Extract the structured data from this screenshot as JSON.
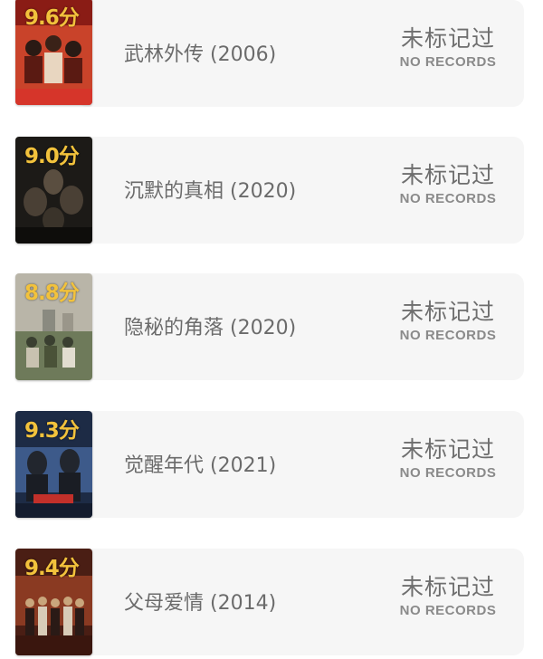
{
  "items": [
    {
      "score": "9.6分",
      "title": "武林外传 (2006)",
      "status_cn": "未标记过",
      "status_en": "NO RECORDS",
      "poster_colors": [
        "#8a1c15",
        "#c9432a",
        "#2a1a14"
      ]
    },
    {
      "score": "9.0分",
      "title": "沉默的真相 (2020)",
      "status_cn": "未标记过",
      "status_en": "NO RECORDS",
      "poster_colors": [
        "#1c1a17",
        "#4a4035",
        "#0e0d0b"
      ]
    },
    {
      "score": "8.8分",
      "title": "隐秘的角落 (2020)",
      "status_cn": "未标记过",
      "status_en": "NO RECORDS",
      "poster_colors": [
        "#b9b5a8",
        "#6e7a5a",
        "#3a3f30"
      ]
    },
    {
      "score": "9.3分",
      "title": "觉醒年代 (2021)",
      "status_cn": "未标记过",
      "status_en": "NO RECORDS",
      "poster_colors": [
        "#1d2b45",
        "#3d5a8a",
        "#c2302a"
      ]
    },
    {
      "score": "9.4分",
      "title": "父母爱情 (2014)",
      "status_cn": "未标记过",
      "status_en": "NO RECORDS",
      "poster_colors": [
        "#4a1e14",
        "#8a3a22",
        "#c9a67c"
      ]
    }
  ]
}
